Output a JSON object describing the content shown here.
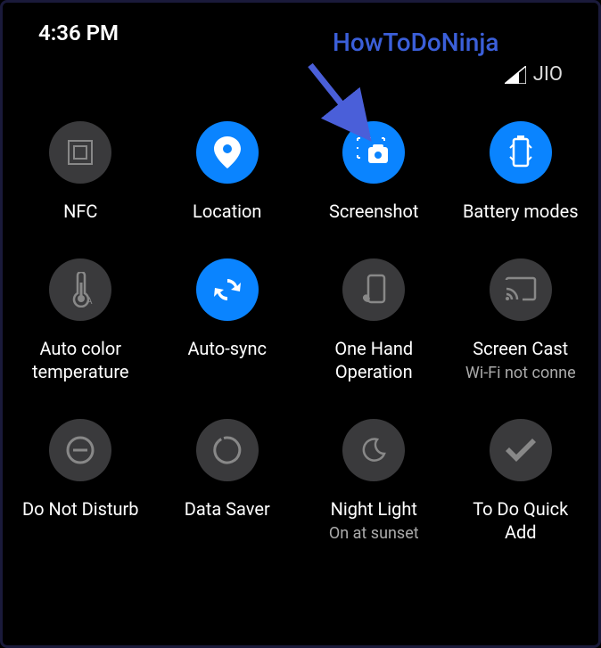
{
  "status": {
    "time": "4:36 PM",
    "carrier": "JIO"
  },
  "annotation": {
    "text": "HowToDoNinja"
  },
  "tiles": {
    "nfc": {
      "label": "NFC",
      "active": false
    },
    "location": {
      "label": "Location",
      "active": true
    },
    "screenshot": {
      "label": "Screenshot",
      "active": true
    },
    "battery": {
      "label": "Battery modes",
      "active": true
    },
    "autocolor": {
      "label": "Auto color\ntemperature",
      "active": false
    },
    "autosync": {
      "label": "Auto-sync",
      "active": true
    },
    "onehand": {
      "label": "One Hand\nOperation",
      "active": false
    },
    "screencast": {
      "label": "Screen Cast",
      "sublabel": "Wi-Fi not conne",
      "active": false
    },
    "dnd": {
      "label": "Do Not Disturb",
      "active": false
    },
    "datasaver": {
      "label": "Data Saver",
      "active": false
    },
    "nightlight": {
      "label": "Night Light",
      "sublabel": "On at sunset",
      "active": false
    },
    "todo": {
      "label": "To Do Quick\nAdd",
      "active": false
    }
  }
}
